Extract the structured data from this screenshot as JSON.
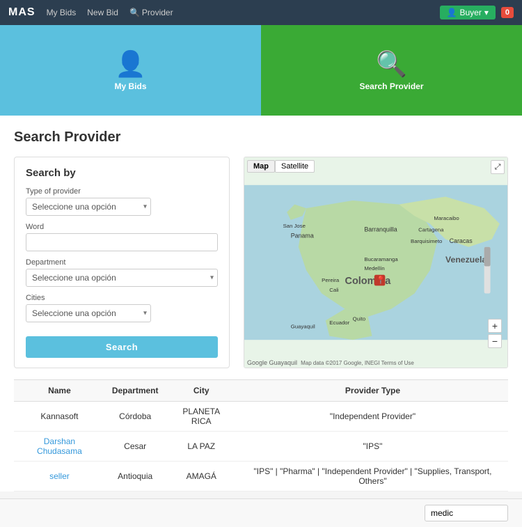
{
  "navbar": {
    "brand": "MAS",
    "links": [
      {
        "label": "My Bids",
        "name": "my-bids-link"
      },
      {
        "label": "New Bid",
        "name": "new-bid-link"
      },
      {
        "label": "Provider",
        "name": "provider-link",
        "icon": "search"
      }
    ],
    "buyer_label": "Buyer",
    "badge_count": "0"
  },
  "hero": {
    "mybids": {
      "label": "My Bids",
      "icon": "👤"
    },
    "provider": {
      "label": "Search Provider",
      "icon": "🔍"
    }
  },
  "page": {
    "title": "Search Provider"
  },
  "search_form": {
    "title": "Search by",
    "type_label": "Type of provider",
    "type_placeholder": "Seleccione una opción",
    "word_label": "Word",
    "word_value": "",
    "department_label": "Department",
    "department_placeholder": "Seleccione una opción",
    "cities_label": "Cities",
    "cities_placeholder": "Seleccione una opción",
    "search_btn": "Search"
  },
  "map": {
    "map_btn": "Map",
    "satellite_btn": "Satellite",
    "attribution": "Google   Guayaquil",
    "attribution2": "Map data ©2017 Google, INEGI  Terms of Use",
    "zoom_in": "+",
    "zoom_out": "−"
  },
  "table": {
    "columns": [
      "Name",
      "Department",
      "City",
      "Provider Type"
    ],
    "rows": [
      {
        "name": "Kannasoft",
        "department": "Córdoba",
        "city": "PLANETA RICA",
        "provider_type": "\"Independent Provider\"",
        "is_link": false
      },
      {
        "name": "Darshan Chudasama",
        "department": "Cesar",
        "city": "LA PAZ",
        "provider_type": "\"IPS\"",
        "is_link": true
      },
      {
        "name": "seller",
        "department": "Antioquia",
        "city": "AMAGÁ",
        "provider_type": "\"IPS\" | \"Pharma\" | \"Independent Provider\" | \"Supplies, Transport, Others\"",
        "is_link": true
      }
    ]
  },
  "footer": {
    "input_value": "medic"
  }
}
